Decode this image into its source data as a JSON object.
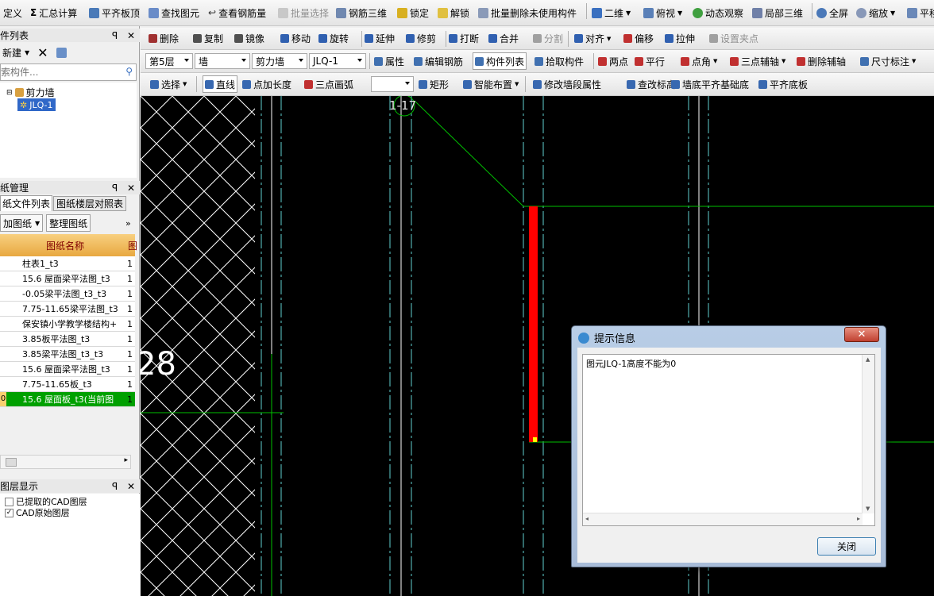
{
  "toolbar1": {
    "items": [
      {
        "label": "定义",
        "icon": "define-icon"
      },
      {
        "label": "汇总计算",
        "icon": "sigma-icon"
      },
      {
        "label": "平齐板顶",
        "icon": "align-top-icon"
      },
      {
        "label": "查找图元",
        "icon": "find-icon"
      },
      {
        "label": "查看钢筋量",
        "icon": "rebar-qty-icon"
      },
      {
        "label": "批量选择",
        "icon": "batch-select-icon"
      },
      {
        "label": "钢筋三维",
        "icon": "rebar-3d-icon"
      },
      {
        "label": "锁定",
        "icon": "lock-icon"
      },
      {
        "label": "解锁",
        "icon": "unlock-icon"
      },
      {
        "label": "批量删除未使用构件",
        "icon": "batch-delete-icon"
      },
      {
        "label": "二维",
        "icon": "2d-icon"
      },
      {
        "label": "俯视",
        "icon": "top-view-icon"
      },
      {
        "label": "动态观察",
        "icon": "orbit-icon"
      },
      {
        "label": "局部三维",
        "icon": "local-3d-icon"
      },
      {
        "label": "全屏",
        "icon": "fullscreen-icon"
      },
      {
        "label": "缩放",
        "icon": "zoom-icon"
      },
      {
        "label": "平移",
        "icon": "pan-icon"
      }
    ]
  },
  "toolbar2": {
    "items": [
      "删除",
      "复制",
      "镜像",
      "移动",
      "旋转",
      "延伸",
      "修剪",
      "打断",
      "合并",
      "分割",
      "对齐",
      "偏移",
      "拉伸",
      "设置夹点"
    ]
  },
  "toolbar3": {
    "floor": "第5层",
    "category": "墙",
    "type": "剪力墙",
    "component": "JLQ-1",
    "items": [
      "属性",
      "编辑钢筋",
      "构件列表",
      "拾取构件",
      "两点",
      "平行",
      "点角",
      "三点辅轴",
      "删除辅轴",
      "尺寸标注"
    ]
  },
  "toolbar4": {
    "items": [
      "选择",
      "直线",
      "点加长度",
      "三点画弧",
      "",
      "矩形",
      "智能布置",
      "修改墙段属性",
      "查改标高",
      "墙底平齐基础底",
      "平齐底板"
    ]
  },
  "comp_panel": {
    "title": "件列表",
    "new_label": "新建",
    "search_placeholder": "索构件...",
    "tree_root": "剪力墙",
    "tree_child": "JLQ-1"
  },
  "drawing_panel": {
    "title": "纸管理",
    "tab1": "纸文件列表",
    "tab2": "图纸楼层对照表",
    "btn_add": "加图纸",
    "btn_manage": "整理图纸",
    "col_name": "图纸名称",
    "col_extra": "图",
    "rows": [
      {
        "name": "柱表1_t3",
        "c": "1"
      },
      {
        "name": "15.6 屋面梁平法图_t3",
        "c": "1"
      },
      {
        "name": "-0.05梁平法图_t3_t3",
        "c": "1"
      },
      {
        "name": "7.75-11.65梁平法图_t3",
        "c": "1"
      },
      {
        "name": "保安镇小学教学楼结构+",
        "c": "1"
      },
      {
        "name": "3.85板平法图_t3",
        "c": "1"
      },
      {
        "name": "3.85梁平法图_t3_t3",
        "c": "1"
      },
      {
        "name": "15.6 屋面梁平法图_t3",
        "c": "1"
      },
      {
        "name": "7.75-11.65板_t3",
        "c": "1"
      },
      {
        "name": "15.6 屋面板_t3(当前图",
        "c": "1",
        "idx": "0"
      }
    ]
  },
  "layer_panel": {
    "title": "图层显示",
    "layer1": "已提取的CAD图层",
    "layer2": "CAD原始图层"
  },
  "canvas": {
    "axis_label": "1-17",
    "big_label": "28"
  },
  "dialog": {
    "title": "提示信息",
    "message": "图元JLQ-1高度不能为0",
    "close_btn": "关闭"
  },
  "colors": {
    "wall_red": "#ff0000",
    "cad_green": "#00c000",
    "axis_cyan": "#5fd0d0",
    "highlight_green": "#00a000"
  }
}
